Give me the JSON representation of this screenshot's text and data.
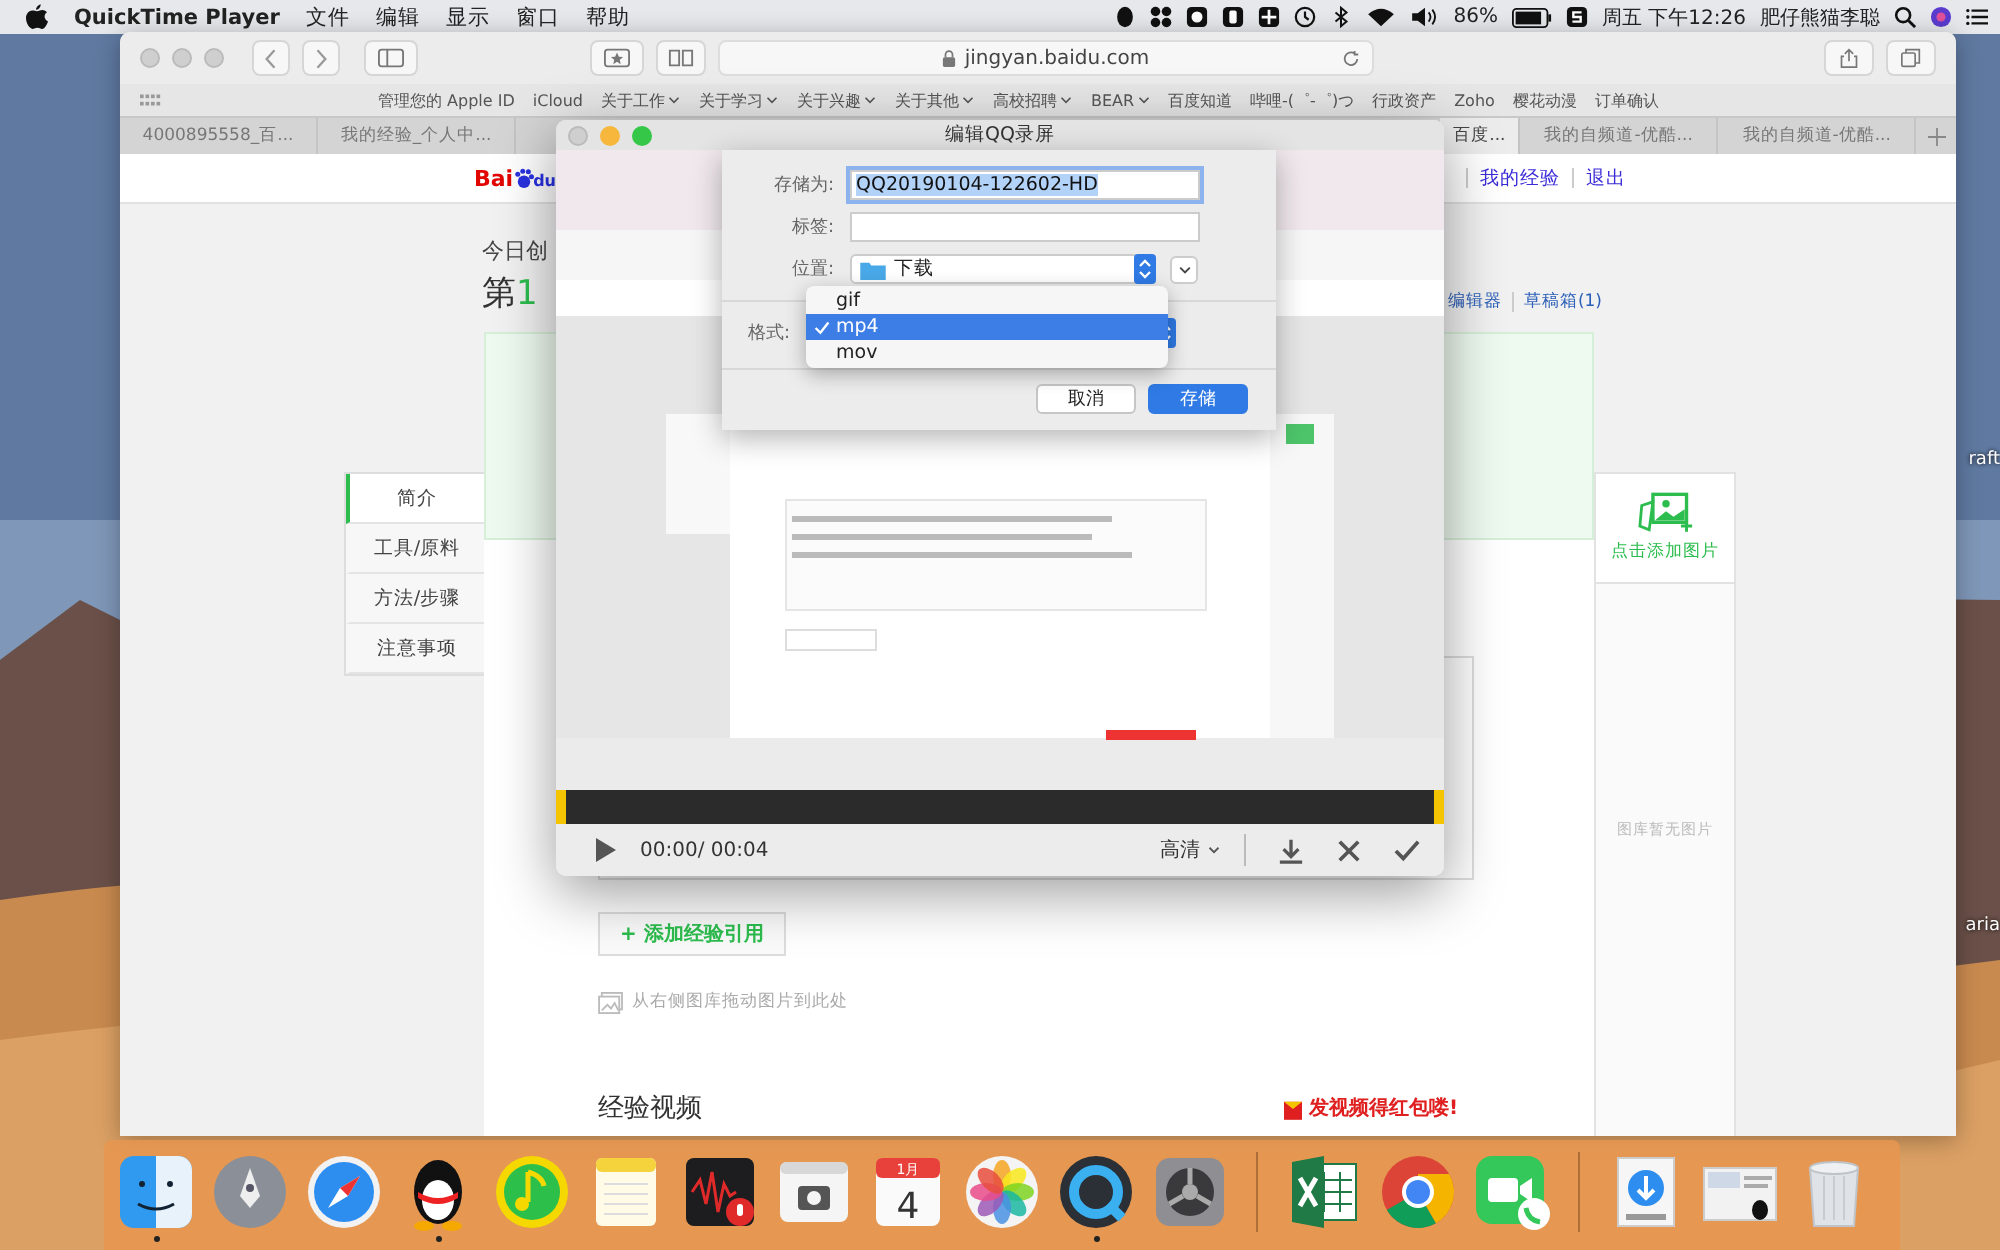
{
  "menu_bar": {
    "app": "QuickTime Player",
    "menus": [
      "文件",
      "编辑",
      "显示",
      "窗口",
      "帮助"
    ],
    "battery": "86%",
    "clock": "周五 下午12:26",
    "user": "肥仔熊猫李聪"
  },
  "desktop": {
    "labels": [
      "raft",
      "aria"
    ]
  },
  "browser": {
    "url": "jingyan.baidu.com",
    "bookmarks": [
      {
        "label": "管理您的 Apple ID",
        "kind": "link"
      },
      {
        "label": "iCloud",
        "kind": "link"
      },
      {
        "label": "关于工作",
        "kind": "folder"
      },
      {
        "label": "关于学习",
        "kind": "folder"
      },
      {
        "label": "关于兴趣",
        "kind": "folder"
      },
      {
        "label": "关于其他",
        "kind": "folder"
      },
      {
        "label": "高校招聘",
        "kind": "folder"
      },
      {
        "label": "BEAR",
        "kind": "folder"
      },
      {
        "label": "百度知道",
        "kind": "link"
      },
      {
        "label": "哔哩-(゜-゜)つ",
        "kind": "link"
      },
      {
        "label": "行政资产",
        "kind": "link"
      },
      {
        "label": "Zoho",
        "kind": "link"
      },
      {
        "label": "樱花动漫",
        "kind": "link"
      },
      {
        "label": "订单确认",
        "kind": "link"
      }
    ],
    "tabs": [
      {
        "label": "4000895558_百...",
        "selected": false
      },
      {
        "label": "我的经验_个人中...",
        "selected": false
      },
      {
        "label": "百度...",
        "selected": true
      },
      {
        "label": "我的自频道-优酷...",
        "selected": false
      },
      {
        "label": "我的自频道-优酷...",
        "selected": false
      }
    ]
  },
  "page": {
    "logo_a": "Bai",
    "logo_b": "du",
    "nav": [
      "我的经验",
      "退出"
    ],
    "subtitle": "今日创",
    "heading": {
      "before": "第",
      "number": "1"
    },
    "links": [
      "编辑器",
      "草稿箱(1)"
    ],
    "sections": [
      {
        "label": "简介",
        "selected": true
      },
      {
        "label": "工具/原料",
        "selected": false
      },
      {
        "label": "方法/步骤",
        "selected": false
      },
      {
        "label": "注意事项",
        "selected": false
      }
    ],
    "add_image": "点击添加图片",
    "gallery_empty": "图库暂无图片",
    "add_reference": "+ 添加经验引用",
    "drop_hint": "从右侧图库拖动图片到此处",
    "video_heading": "经验视频",
    "promo": "发视频得红包喽!"
  },
  "player": {
    "title": "编辑QQ录屏",
    "time": "00:00/ 00:04",
    "quality": "高清"
  },
  "save_sheet": {
    "save_as": {
      "label": "存储为:",
      "value": "QQ20190104-122602-HD"
    },
    "tags": {
      "label": "标签:"
    },
    "location": {
      "label": "位置:",
      "value": "下载"
    },
    "format": {
      "label": "格式:",
      "options": [
        {
          "label": "gif",
          "selected": false
        },
        {
          "label": "mp4",
          "selected": true
        },
        {
          "label": "mov",
          "selected": false
        }
      ]
    },
    "buttons": [
      {
        "label": "取消",
        "kind": "secondary"
      },
      {
        "label": "存储",
        "kind": "primary"
      }
    ]
  },
  "dock": {
    "sections": [
      [
        {
          "kind": "finder",
          "running": true
        },
        {
          "kind": "launchpad",
          "running": false
        },
        {
          "kind": "safari",
          "running": false
        },
        {
          "kind": "qq",
          "running": true
        },
        {
          "kind": "music",
          "running": false
        },
        {
          "kind": "notes",
          "running": false
        },
        {
          "kind": "voice",
          "running": false
        },
        {
          "kind": "screenshot",
          "running": false
        },
        {
          "kind": "calendar",
          "running": false,
          "month": "1月",
          "day": "4"
        },
        {
          "kind": "photos",
          "running": false
        },
        {
          "kind": "quicktime",
          "running": true
        },
        {
          "kind": "settings",
          "running": false
        }
      ],
      [
        {
          "kind": "excel",
          "running": false
        },
        {
          "kind": "chrome",
          "running": false
        },
        {
          "kind": "facetime",
          "running": false
        }
      ],
      [
        {
          "kind": "downloads",
          "running": false
        },
        {
          "kind": "documents",
          "running": false
        },
        {
          "kind": "trash",
          "running": false
        }
      ]
    ]
  }
}
